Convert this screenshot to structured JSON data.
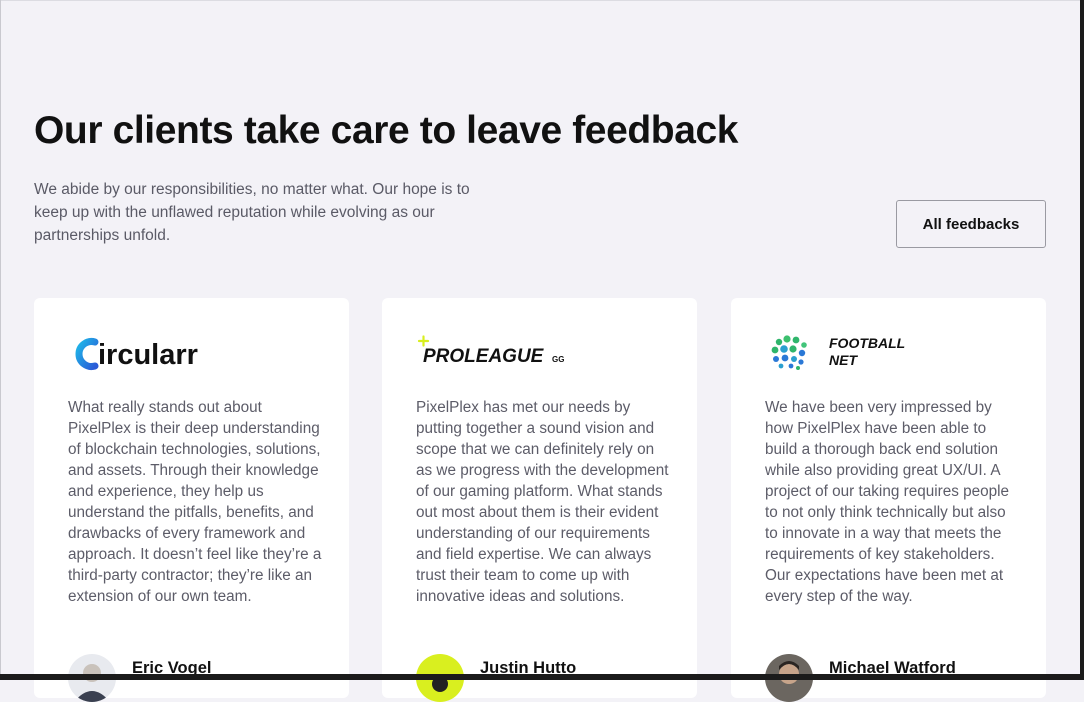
{
  "section": {
    "title": "Our clients take care to leave feedback",
    "intro": "We abide by our responsibilities, no matter what. Our hope is to keep up with the unflawed reputation while evolving as our partnerships unfold.",
    "all_feedbacks_label": "All feedbacks"
  },
  "cards": [
    {
      "logo_text": "Circularr",
      "quote": "What really stands out about PixelPlex is their deep understanding of blockchain technologies, solutions, and assets. Through their knowledge and experience, they help us understand the pitfalls, benefits, and drawbacks of every framework and approach. It doesn’t feel like they’re a third-party contractor; they’re like an extension of our own team.",
      "author": "Eric Vogel"
    },
    {
      "logo_text": "PROLEAGUE",
      "logo_suffix": "GG",
      "quote": "PixelPlex has met our needs by putting together a sound vision and scope that we can definitely rely on as we progress with the development of our gaming platform. What stands out most about them is their evident understanding of our requirements and field expertise. We can always trust their team to come up with innovative ideas and solutions.",
      "author": "Justin Hutto"
    },
    {
      "logo_text_line1": "FOOTBALL",
      "logo_text_line2": "NET",
      "quote": "We have been very impressed by how PixelPlex have been able to build a thorough back end solution while also providing great UX/UI. A project of our taking requires people to not only think technically but also to innovate in a way that meets the requirements of key stakeholders. Our expectations have been met at every step of the way.",
      "author": "Michael Watford"
    }
  ],
  "colors": {
    "page_bg": "#f3f2f7",
    "card_bg": "#ffffff",
    "proleague_accent": "#d9ef1f",
    "circularr_gradient": [
      "#1fb6e8",
      "#2a5bd7"
    ],
    "football_net_dots": [
      "#2fb56b",
      "#2a78d6"
    ]
  }
}
